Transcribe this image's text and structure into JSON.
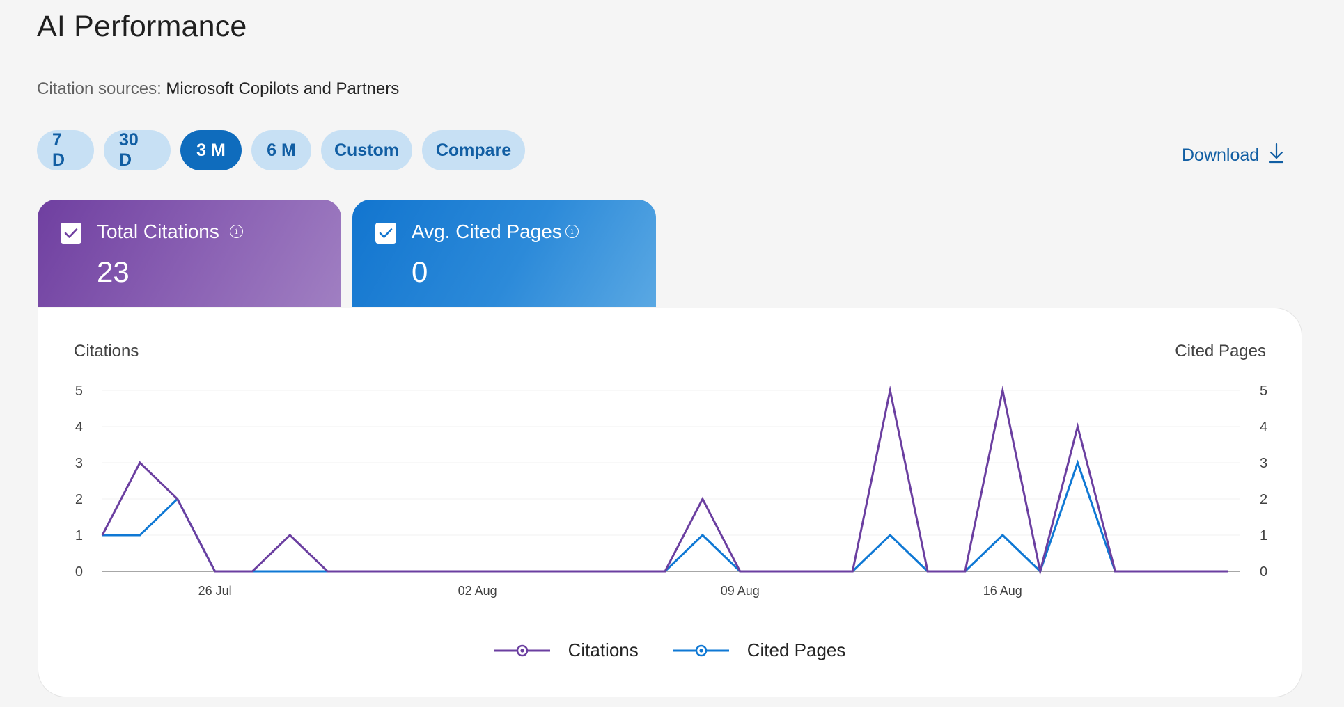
{
  "header": {
    "title": "AI Performance"
  },
  "citation": {
    "label": "Citation sources: ",
    "value": "Microsoft Copilots and Partners"
  },
  "ranges": [
    "7 D",
    "30 D",
    "3 M",
    "6 M",
    "Custom",
    "Compare"
  ],
  "active_range": "3 M",
  "download_label": "Download",
  "cards": [
    {
      "label": "Total Citations",
      "value": "23",
      "checked": true,
      "color": "#7b4fae"
    },
    {
      "label": "Avg. Cited Pages",
      "value": "0",
      "checked": true,
      "color": "#1b7fd4"
    }
  ],
  "colors": {
    "citations": "#6b3fa0",
    "cited_pages": "#0f78d4",
    "accent": "#0f6cbd",
    "pill": "#c7e0f4"
  },
  "chart_data": {
    "type": "line",
    "ylabel_left": "Citations",
    "ylabel_right": "Cited Pages",
    "ylim": [
      0,
      5
    ],
    "yticks": [
      0,
      1,
      2,
      3,
      4,
      5
    ],
    "x_tick_labels": [
      {
        "label": "26 Jul",
        "index": 3
      },
      {
        "label": "02 Aug",
        "index": 10
      },
      {
        "label": "09 Aug",
        "index": 17
      },
      {
        "label": "16 Aug",
        "index": 24
      }
    ],
    "series": [
      {
        "name": "Citations",
        "values": [
          1,
          3,
          2,
          0,
          0,
          1,
          0,
          0,
          0,
          0,
          0,
          0,
          0,
          0,
          0,
          0,
          2,
          0,
          0,
          0,
          0,
          5,
          0,
          0,
          5,
          0,
          4,
          0,
          0,
          0,
          0
        ]
      },
      {
        "name": "Cited Pages",
        "values": [
          1,
          1,
          2,
          0,
          0,
          0,
          0,
          0,
          0,
          0,
          0,
          0,
          0,
          0,
          0,
          0,
          1,
          0,
          0,
          0,
          0,
          1,
          0,
          0,
          1,
          0,
          3,
          0,
          0,
          0,
          0
        ]
      }
    ],
    "grid": true,
    "legend_position": "bottom"
  }
}
